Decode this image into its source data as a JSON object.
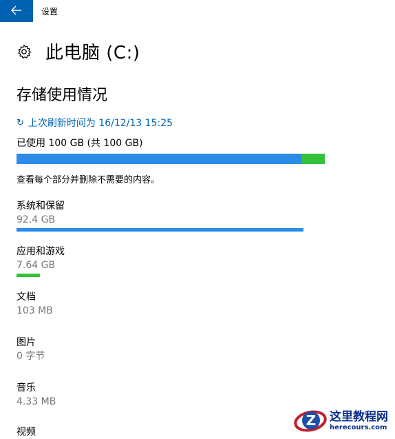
{
  "app": {
    "title": "设置"
  },
  "header": {
    "title": "此电脑 (C:)"
  },
  "storage": {
    "section_title": "存储使用情况",
    "refresh_text": "上次刷新时间为 16/12/13 15:25",
    "used_text": "已使用 100 GB (共 100 GB)",
    "description": "查看每个部分并删除不需要的内容。",
    "total_bar": {
      "segments": [
        {
          "name": "系统和保留",
          "fraction": 0.924,
          "color": "#2b8ce8"
        },
        {
          "name": "应用和游戏",
          "fraction": 0.0764,
          "color": "#35c13a"
        }
      ]
    },
    "categories": [
      {
        "name": "系统和保留",
        "size": "92.4 GB",
        "fraction": 0.924,
        "color": "#2b8ce8"
      },
      {
        "name": "应用和游戏",
        "size": "7.64 GB",
        "fraction": 0.0764,
        "color": "#35c13a"
      },
      {
        "name": "文档",
        "size": "103 MB",
        "fraction": 0,
        "color": "#2b8ce8"
      },
      {
        "name": "图片",
        "size": "0 字节",
        "fraction": 0,
        "color": "#2b8ce8"
      },
      {
        "name": "音乐",
        "size": "4.33 MB",
        "fraction": 0,
        "color": "#2b8ce8"
      },
      {
        "name": "视频",
        "size": "",
        "fraction": 0,
        "color": "#2b8ce8"
      }
    ]
  },
  "watermark": {
    "cn": "这里教程网",
    "en": "herecours.com"
  },
  "colors": {
    "accent": "#0063b1",
    "blue_bar": "#2b8ce8",
    "green_bar": "#35c13a"
  }
}
